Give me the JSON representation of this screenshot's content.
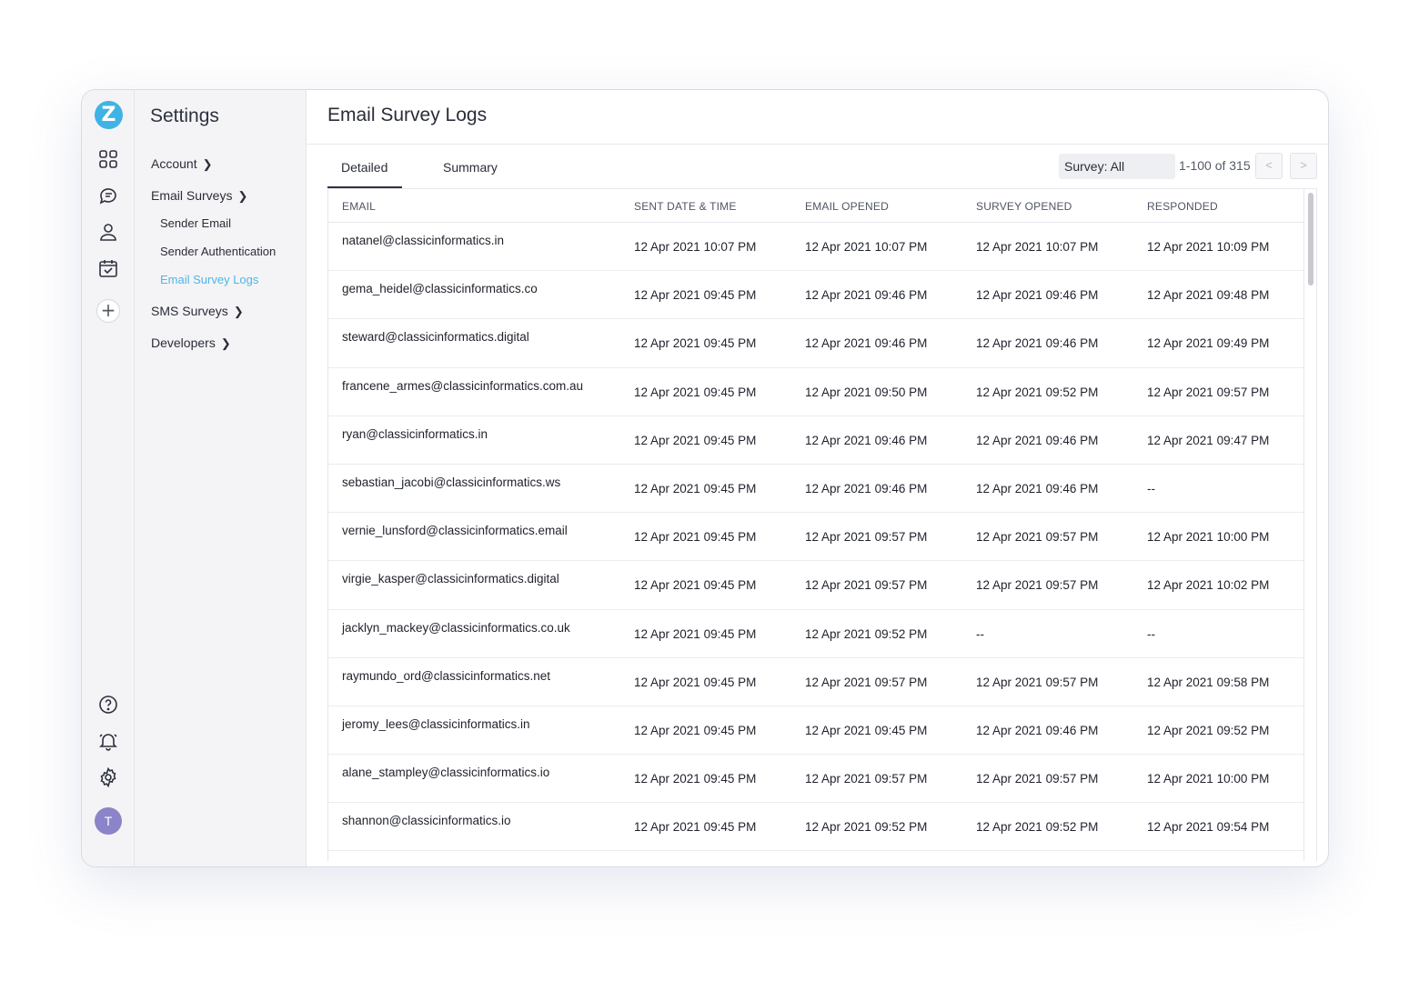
{
  "app": {
    "logo_letter": "Z",
    "avatar_initial": "T",
    "accent_color": "#4db6e6",
    "rail_icons": [
      "dashboard-icon",
      "chat-survey-icon",
      "user-icon",
      "calendar-check-icon",
      "add-icon"
    ],
    "rail_bottom_icons": [
      "help-icon",
      "bell-icon",
      "gear-icon"
    ]
  },
  "sidebar": {
    "title": "Settings",
    "account": "Account",
    "email_surveys": "Email Surveys",
    "sender_email": "Sender Email",
    "sender_auth": "Sender Authentication",
    "email_survey_logs": "Email Survey Logs",
    "sms_surveys": "SMS Surveys",
    "developers": "Developers"
  },
  "main": {
    "title": "Email Survey Logs",
    "tab_detailed": "Detailed",
    "tab_summary": "Summary",
    "survey_filter": "Survey: All",
    "pager_text": "1-100 of 315",
    "pager_prev": "<",
    "pager_next": ">"
  },
  "table": {
    "headers": [
      "EMAIL",
      "SENT DATE & TIME",
      "EMAIL OPENED",
      "SURVEY OPENED",
      "RESPONDED"
    ],
    "rows": [
      [
        "natanel@classicinformatics.in",
        "12 Apr 2021 10:07 PM",
        "12 Apr 2021 10:07 PM",
        "12 Apr 2021 10:07 PM",
        "12 Apr 2021 10:09 PM"
      ],
      [
        "gema_heidel@classicinformatics.co",
        "12 Apr 2021 09:45 PM",
        "12 Apr 2021 09:46 PM",
        "12 Apr 2021 09:46 PM",
        "12 Apr 2021 09:48 PM"
      ],
      [
        "steward@classicinformatics.digital",
        "12 Apr 2021 09:45 PM",
        "12 Apr 2021 09:46 PM",
        "12 Apr 2021 09:46 PM",
        "12 Apr 2021 09:49 PM"
      ],
      [
        "francene_armes@classicinformatics.com.au",
        "12 Apr 2021 09:45 PM",
        "12 Apr 2021 09:50 PM",
        "12 Apr 2021 09:52 PM",
        "12 Apr 2021 09:57 PM"
      ],
      [
        "ryan@classicinformatics.in",
        "12 Apr 2021 09:45 PM",
        "12 Apr 2021 09:46 PM",
        "12 Apr 2021 09:46 PM",
        "12 Apr 2021 09:47 PM"
      ],
      [
        "sebastian_jacobi@classicinformatics.ws",
        "12 Apr 2021 09:45 PM",
        "12 Apr 2021 09:46 PM",
        "12 Apr 2021 09:46 PM",
        "--"
      ],
      [
        "vernie_lunsford@classicinformatics.email",
        "12 Apr 2021 09:45 PM",
        "12 Apr 2021 09:57 PM",
        "12 Apr 2021 09:57 PM",
        "12 Apr 2021 10:00 PM"
      ],
      [
        "virgie_kasper@classicinformatics.digital",
        "12 Apr 2021 09:45 PM",
        "12 Apr 2021 09:57 PM",
        "12 Apr 2021 09:57 PM",
        "12 Apr 2021 10:02 PM"
      ],
      [
        "jacklyn_mackey@classicinformatics.co.uk",
        "12 Apr 2021 09:45 PM",
        "12 Apr 2021 09:52 PM",
        "--",
        "--"
      ],
      [
        "raymundo_ord@classicinformatics.net",
        "12 Apr 2021 09:45 PM",
        "12 Apr 2021 09:57 PM",
        "12 Apr 2021 09:57 PM",
        "12 Apr 2021 09:58 PM"
      ],
      [
        "jeromy_lees@classicinformatics.in",
        "12 Apr 2021 09:45 PM",
        "12 Apr 2021 09:45 PM",
        "12 Apr 2021 09:46 PM",
        "12 Apr 2021 09:52 PM"
      ],
      [
        "alane_stampley@classicinformatics.io",
        "12 Apr 2021 09:45 PM",
        "12 Apr 2021 09:57 PM",
        "12 Apr 2021 09:57 PM",
        "12 Apr 2021 10:00 PM"
      ],
      [
        "shannon@classicinformatics.io",
        "12 Apr 2021 09:45 PM",
        "12 Apr 2021 09:52 PM",
        "12 Apr 2021 09:52 PM",
        "12 Apr 2021 09:54 PM"
      ]
    ]
  }
}
